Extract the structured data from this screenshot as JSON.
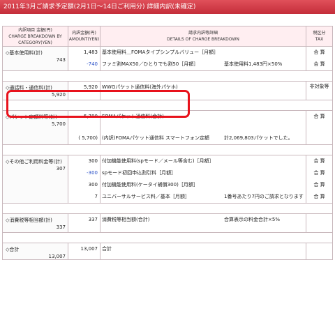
{
  "title": "2011年3月ご請求予定額(2月1日～14日ご利用分) 詳細内訳(未確定)",
  "headers": {
    "category": [
      "内訳項目 金額(円)",
      "CHARGE BREAKDOWN BY",
      "CATEGORY(YEN)"
    ],
    "amount": [
      "内訳金額(円)",
      "AMOUNT(YEN)"
    ],
    "details": [
      "請求内訳等詳細",
      "DETAILS OF CHARGE BREAKDOWN"
    ],
    "tax": [
      "税区分",
      "TAX"
    ]
  },
  "sections": [
    {
      "name": "◇基本使用料(計)",
      "total": "743",
      "rows": [
        {
          "amount": "1,483",
          "detail": "基本使用料＿FOMAタイプシンプルバリュー［月額］",
          "sub": "",
          "tax": "合 算"
        },
        {
          "amount": "-740",
          "blue": true,
          "detail": "ファミ割MAX50／ひとりでも割50［月額］",
          "sub": "基本使用料1,483円×50%",
          "tax": "合 算"
        }
      ]
    },
    {
      "name": "◇通話料・通信料(計)",
      "total": "5,920",
      "rows": [
        {
          "amount": "5,920",
          "detail": "WWGパケット通信料(海外パケホ)",
          "sub": "",
          "tax": "非対象等"
        }
      ]
    },
    {
      "name": "◇パケット定額料等(計)",
      "total": "5,700",
      "rows": [
        {
          "amount": "5,700",
          "detail": "FOMAパケット通信料(合計)",
          "sub": "",
          "tax": "合 算"
        },
        {
          "amount": "( 5,700)",
          "detail": "(内訳)FOMAパケット通信料 スマートフォン定額",
          "sub": "計2,069,803パケットでした。",
          "tax": ""
        }
      ]
    },
    {
      "name": "◇その他ご利用料金等(計)",
      "total": "307",
      "rows": [
        {
          "amount": "300",
          "detail": "付加機能使用料(spモード／メール等含む)［月額］",
          "sub": "",
          "tax": "合 算"
        },
        {
          "amount": "-300",
          "blue": true,
          "detail": "spモード初回申込割引料［月額］",
          "sub": "",
          "tax": "合 算"
        },
        {
          "amount": "300",
          "detail": "付加機能使用料(ケータイ補償300)［月額］",
          "sub": "",
          "tax": "合 算"
        },
        {
          "amount": "7",
          "detail": "ユニバーサルサービス料／基本［月額］",
          "sub": "1番号あたり7円のご請求となります",
          "tax": "合 算"
        }
      ]
    },
    {
      "name": "◇消費税等相当額(計)",
      "total": "337",
      "rows": [
        {
          "amount": "337",
          "detail": "消費税等相当額(合計)",
          "sub": "合算表示の料金合計×5%",
          "tax": ""
        }
      ]
    },
    {
      "name": "◇合計",
      "total": "13,007",
      "rows": [
        {
          "amount": "13,007",
          "detail": "合計",
          "sub": "",
          "tax": ""
        }
      ]
    }
  ]
}
